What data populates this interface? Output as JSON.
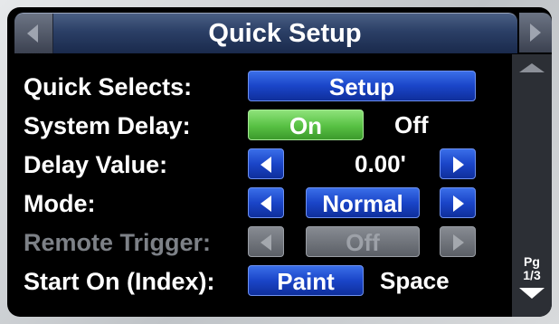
{
  "header": {
    "title": "Quick Setup"
  },
  "page_indicator": {
    "line1": "Pg",
    "line2": "1/3"
  },
  "rows": {
    "quick_selects": {
      "label": "Quick Selects:",
      "value": "Setup"
    },
    "system_delay": {
      "label": "System Delay:",
      "on": "On",
      "off": "Off",
      "selected": "On"
    },
    "delay_value": {
      "label": "Delay Value:",
      "value": "0.00'"
    },
    "mode": {
      "label": "Mode:",
      "value": "Normal"
    },
    "remote_trigger": {
      "label": "Remote Trigger:",
      "value": "Off",
      "enabled": false
    },
    "start_on": {
      "label": "Start On (Index):",
      "option1": "Paint",
      "option2": "Space",
      "selected": "Paint"
    }
  },
  "colors": {
    "button_blue": "#1a45c8",
    "button_green": "#57c043",
    "disabled_gray": "#5b5f66",
    "header_navy": "#2b3f66"
  },
  "icons": [
    "chevron-left-icon",
    "chevron-right-icon",
    "scroll-up-icon",
    "scroll-down-icon"
  ]
}
